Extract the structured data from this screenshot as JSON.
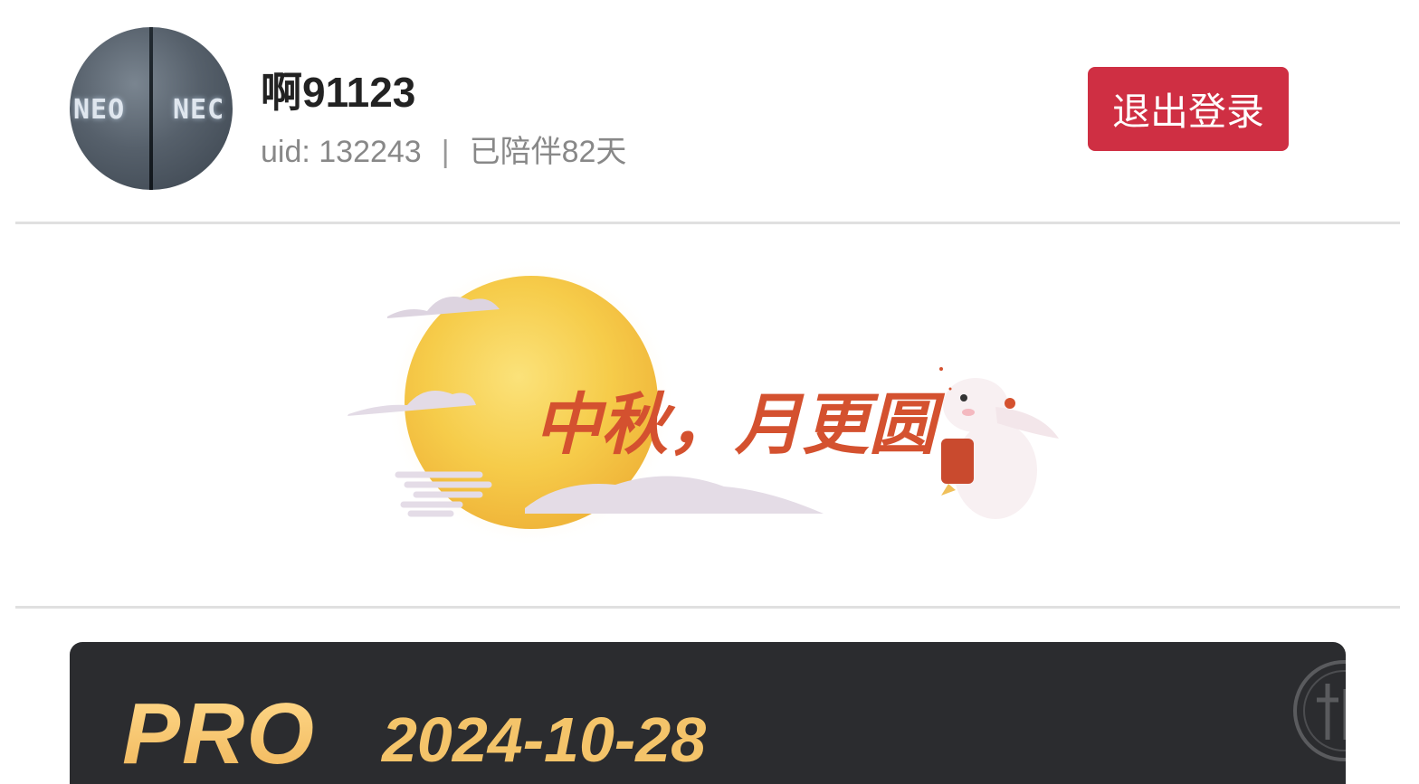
{
  "profile": {
    "username": "啊91123",
    "uid_text": "uid: 132243",
    "separator": "|",
    "days_text": "已陪伴82天",
    "avatar_text_left": "NEO",
    "avatar_text_right": "NEC"
  },
  "actions": {
    "logout_label": "退出登录"
  },
  "banner": {
    "text": "中秋，月更圆"
  },
  "membership": {
    "tier": "PRO",
    "expiry_date": "2024-10-28"
  },
  "colors": {
    "logout_button": "#cf2f43",
    "pro_card_bg": "#2b2c2f",
    "pro_gold": "#f4c46a",
    "banner_text": "#d4512f",
    "moon": "#f6cc4a"
  }
}
